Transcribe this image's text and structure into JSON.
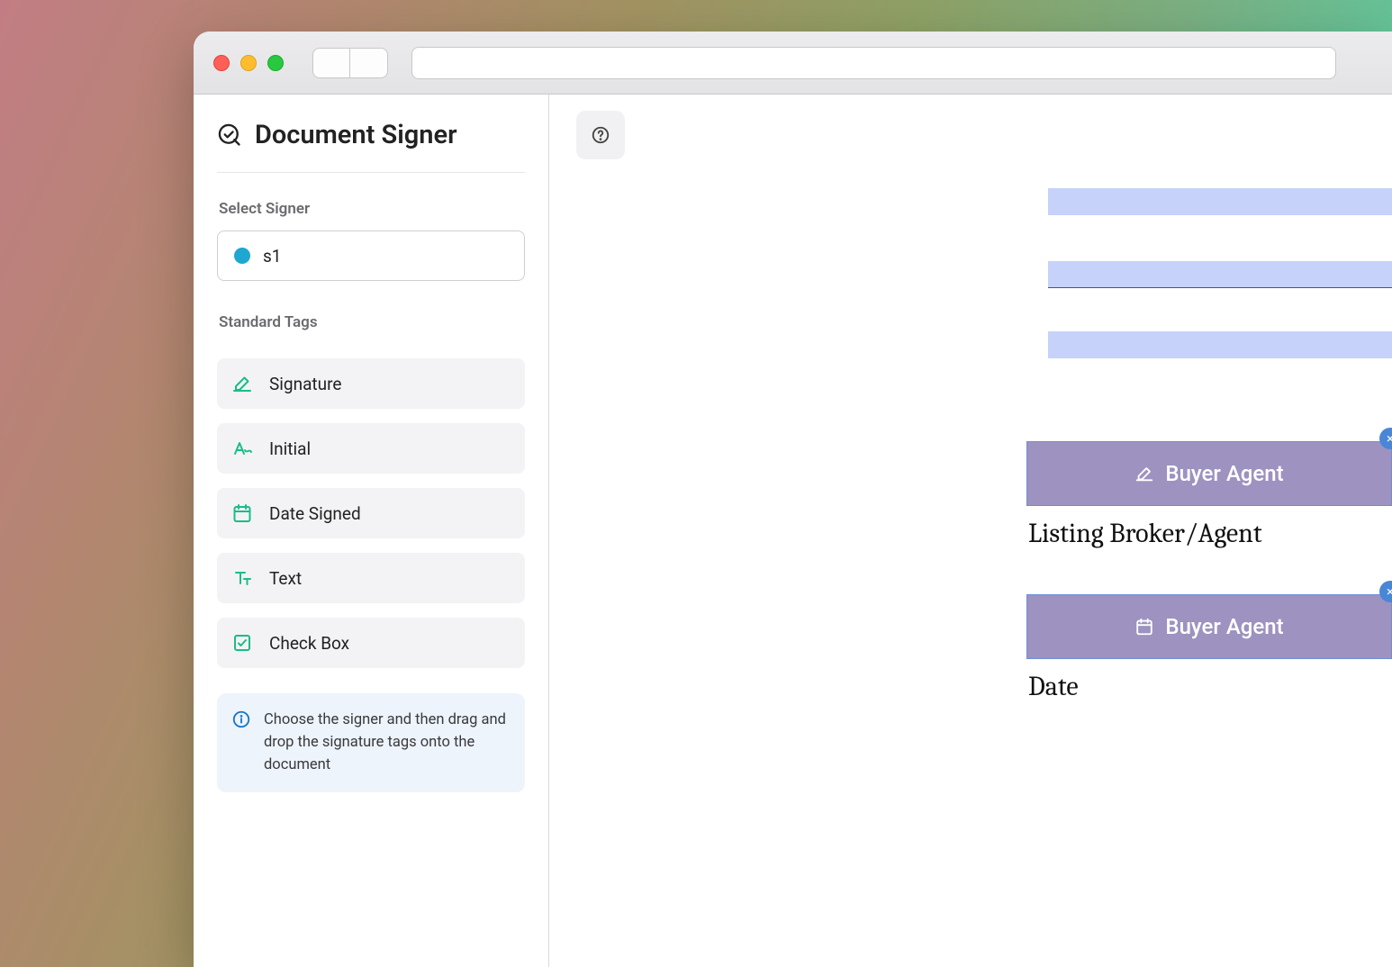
{
  "sidebar": {
    "title": "Document Signer",
    "select_signer_label": "Select Signer",
    "selected_signer": "s1",
    "signer_color": "#1ea7d1",
    "standard_tags_label": "Standard Tags",
    "tags": [
      {
        "icon": "signature-icon",
        "label": "Signature"
      },
      {
        "icon": "initial-icon",
        "label": "Initial"
      },
      {
        "icon": "calendar-icon",
        "label": "Date Signed"
      },
      {
        "icon": "text-icon",
        "label": "Text"
      },
      {
        "icon": "checkbox-icon",
        "label": "Check Box"
      }
    ],
    "info_text": "Choose the signer and then drag and drop the signature tags onto the document"
  },
  "document": {
    "placed_tags": [
      {
        "type": "signature",
        "label": "Buyer Agent"
      },
      {
        "type": "date",
        "label": "Buyer Agent"
      }
    ],
    "labels": [
      "Listing Broker/Agent",
      "Date"
    ]
  },
  "colors": {
    "accent_green": "#1abc8a",
    "field_fill": "#c7d2fb",
    "tag_fill": "#9e92c0"
  }
}
